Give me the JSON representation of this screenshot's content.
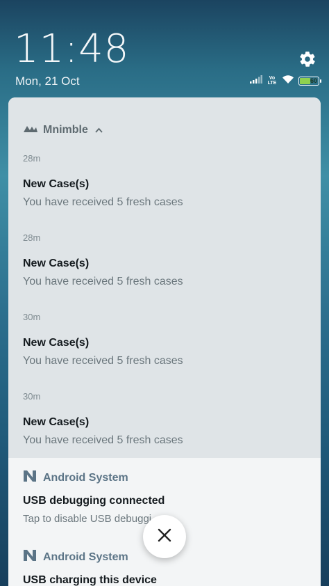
{
  "status": {
    "time": "11:48",
    "date": "Mon, 21 Oct",
    "network_label_top": "Vo",
    "network_label_bottom": "LTE",
    "battery_level": 60,
    "battery_text": "60"
  },
  "icons": {
    "settings": "gear-icon",
    "signal": "signal-icon",
    "wifi": "wifi-icon",
    "battery": "battery-icon",
    "app": "mnimble-logo-icon",
    "android": "android-n-icon",
    "close": "close-icon"
  },
  "mnimble": {
    "app_name": "Mnimble",
    "notifications": [
      {
        "time": "28m",
        "title": "New Case(s)",
        "text": "You have received 5 fresh cases"
      },
      {
        "time": "28m",
        "title": "New Case(s)",
        "text": "You have received 5 fresh cases"
      },
      {
        "time": "30m",
        "title": "New Case(s)",
        "text": "You have received 5 fresh cases"
      },
      {
        "time": "30m",
        "title": "New Case(s)",
        "text": "You have received 5 fresh cases"
      }
    ]
  },
  "android": {
    "notifications": [
      {
        "app_name": "Android System",
        "title": "USB debugging connected",
        "text": "Tap to disable USB debuggi"
      },
      {
        "app_name": "Android System",
        "title": "USB charging this device",
        "text": ""
      }
    ]
  },
  "colors": {
    "battery_fill": "#8fd14f",
    "panel": "#dfe4e7",
    "android_group": "#f3f5f6"
  }
}
